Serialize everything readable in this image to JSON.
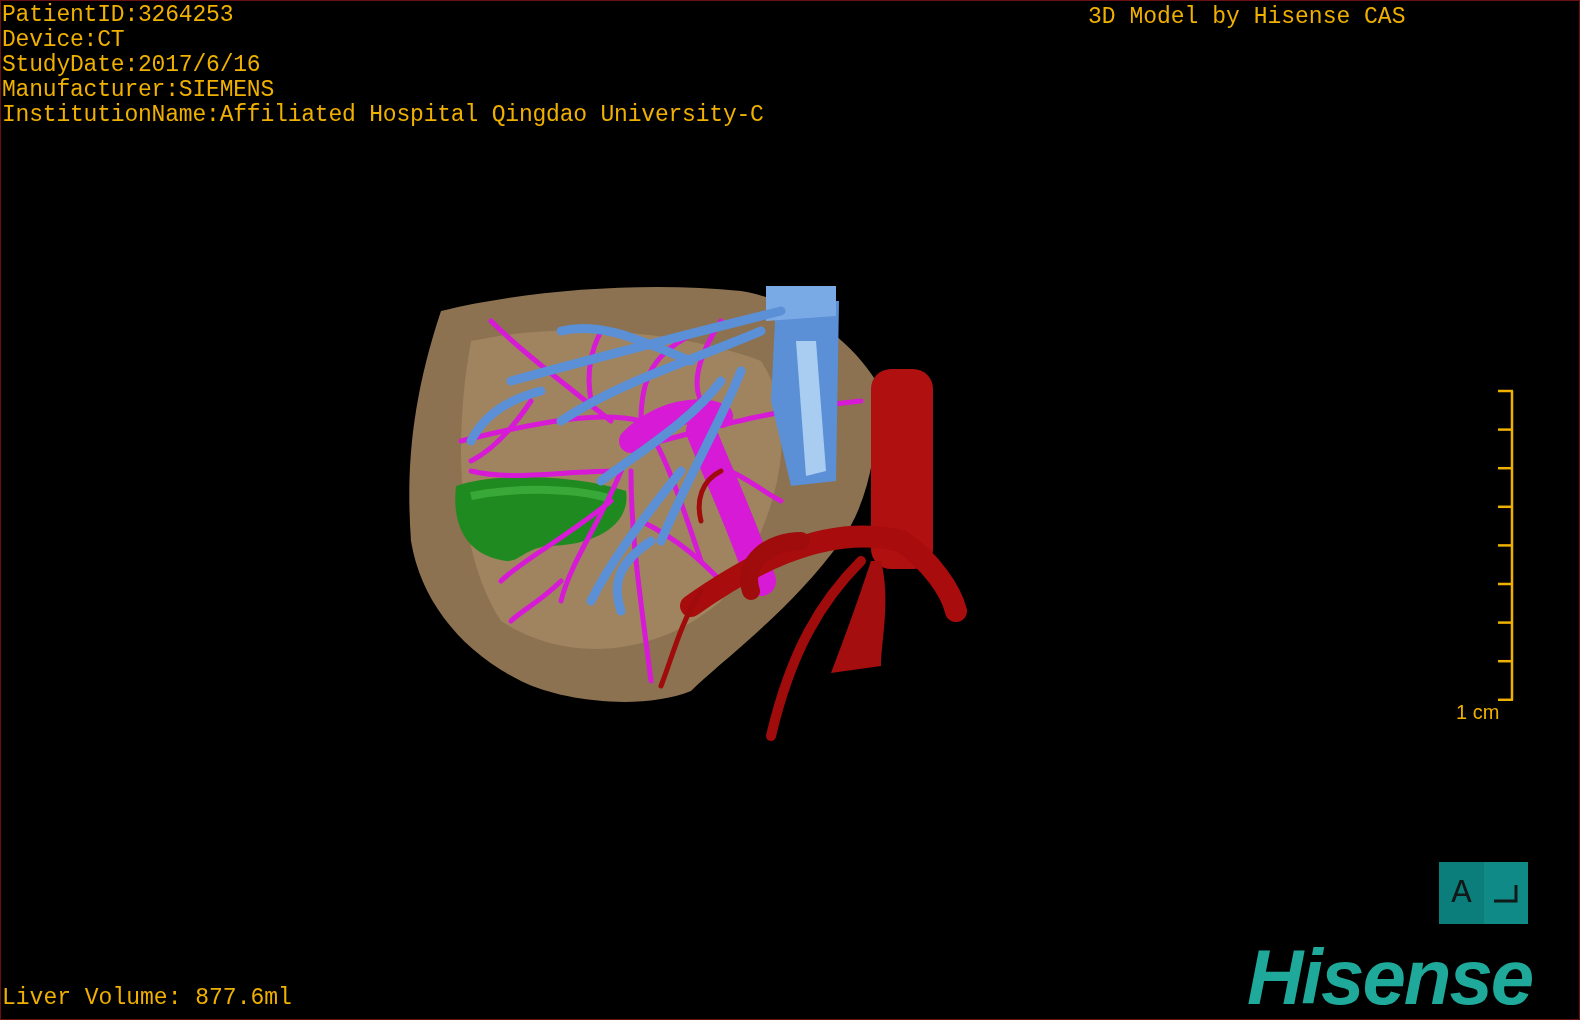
{
  "info_lines": [
    "PatientID:3264253",
    "Device:CT",
    "StudyDate:2017/6/16",
    "Manufacturer:SIEMENS",
    "InstitutionName:Affiliated Hospital Qingdao University-C"
  ],
  "credit": "3D Model by Hisense CAS",
  "scale_bar": {
    "label": "1 cm"
  },
  "orientation": {
    "label": "A"
  },
  "measurement": "Liver Volume: 877.6ml",
  "logo": "Hisense"
}
